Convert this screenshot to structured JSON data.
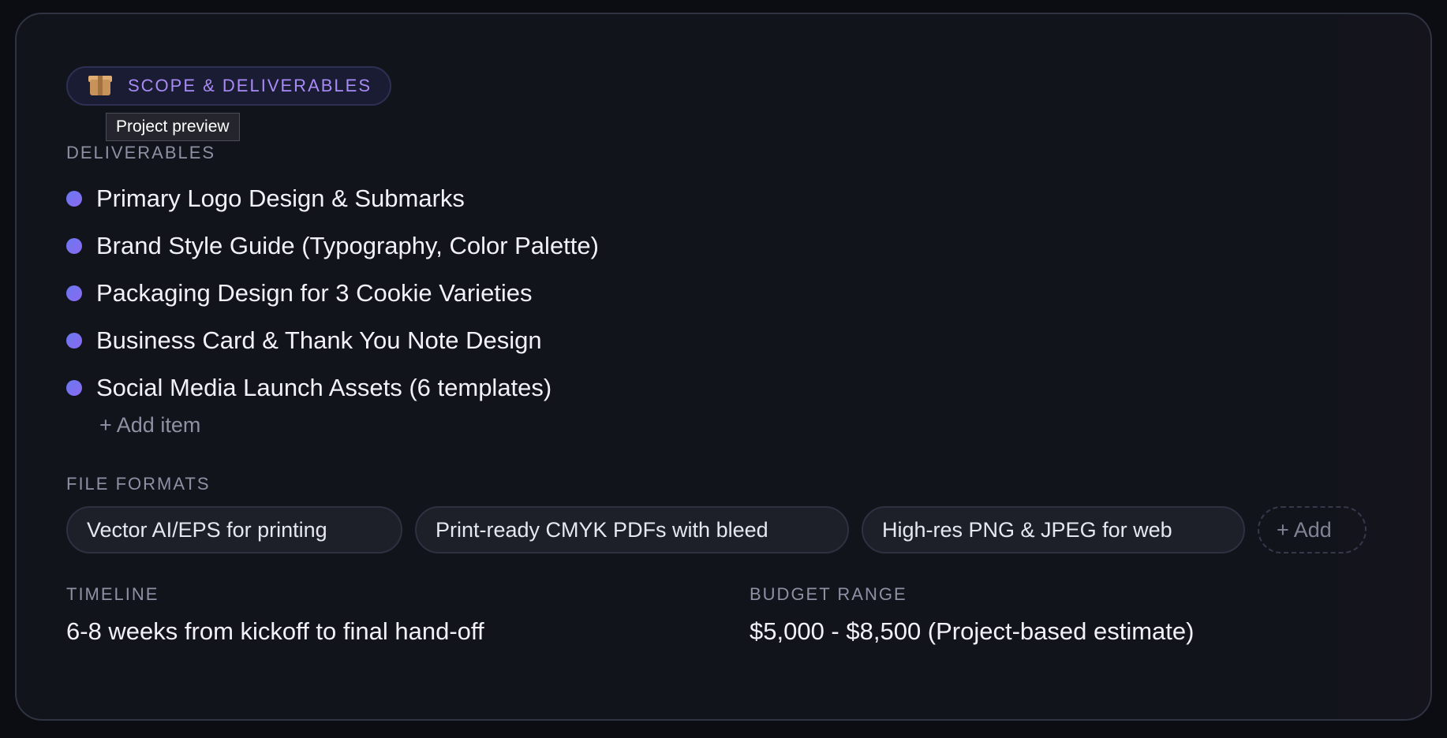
{
  "badge": {
    "icon": "package-icon",
    "label": "SCOPE & DELIVERABLES",
    "accent": "#a98bf7"
  },
  "tooltip": {
    "text": "Project preview"
  },
  "deliverables": {
    "label": "DELIVERABLES",
    "items": [
      "Primary Logo Design & Submarks",
      "Brand Style Guide (Typography, Color Palette)",
      "Packaging Design for 3 Cookie Varieties",
      "Business Card & Thank You Note Design",
      "Social Media Launch Assets (6 templates)"
    ],
    "add_label": "+ Add item"
  },
  "file_formats": {
    "label": "FILE FORMATS",
    "items": [
      "Vector AI/EPS for printing",
      "Print-ready CMYK PDFs with bleed",
      "High-res PNG & JPEG for web"
    ],
    "add_label": "+ Add"
  },
  "timeline": {
    "label": "TIMELINE",
    "value": "6-8 weeks from kickoff to final hand-off"
  },
  "budget": {
    "label": "BUDGET RANGE",
    "value": "$5,000 - $8,500 (Project-based estimate)"
  },
  "colors": {
    "background": "#0b0d12",
    "card": "#12141c",
    "bullet": "#7a72f0"
  }
}
